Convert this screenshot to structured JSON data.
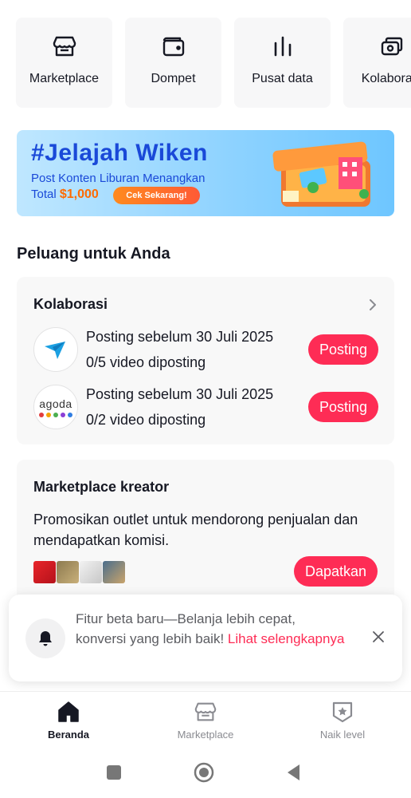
{
  "shortcuts": [
    {
      "label": "Marketplace",
      "icon": "store-icon"
    },
    {
      "label": "Dompet",
      "icon": "wallet-icon"
    },
    {
      "label": "Pusat data",
      "icon": "bar-chart-icon"
    },
    {
      "label": "Kolaborasi",
      "icon": "collaboration-icon"
    }
  ],
  "banner": {
    "title": "#Jelajah Wiken",
    "subtitle": "Post Konten Liburan Menangkan",
    "total_prefix": "Total",
    "total_amount": "$1,000",
    "cta": "Cek Sekarang!",
    "colors": {
      "title": "#1a49d8",
      "amount": "#ff6a00"
    }
  },
  "section_title": "Peluang untuk Anda",
  "collab": {
    "title": "Kolaborasi",
    "items": [
      {
        "brand": "traveloka",
        "deadline": "Posting sebelum 30 Juli 2025",
        "progress": "0/5 video diposting",
        "button": "Posting"
      },
      {
        "brand": "agoda",
        "logo_text": "agoda",
        "deadline": "Posting sebelum 30 Juli 2025",
        "progress": "0/2 video diposting",
        "button": "Posting"
      }
    ]
  },
  "market": {
    "title": "Marketplace kreator",
    "description": "Promosikan outlet untuk mendorong penjualan dan mendapatkan komisi.",
    "button": "Dapatkan"
  },
  "toast": {
    "text": "Fitur beta baru—Belanja lebih cepat, konversi yang lebih baik!",
    "link": "Lihat selengkapnya"
  },
  "bottom_nav": [
    {
      "label": "Beranda",
      "icon": "home-icon",
      "active": true
    },
    {
      "label": "Marketplace",
      "icon": "store-icon",
      "active": false
    },
    {
      "label": "Naik level",
      "icon": "level-badge-icon",
      "active": false
    }
  ],
  "colors": {
    "accent": "#fe2c55",
    "text": "#161823",
    "muted": "#8a8b91"
  }
}
